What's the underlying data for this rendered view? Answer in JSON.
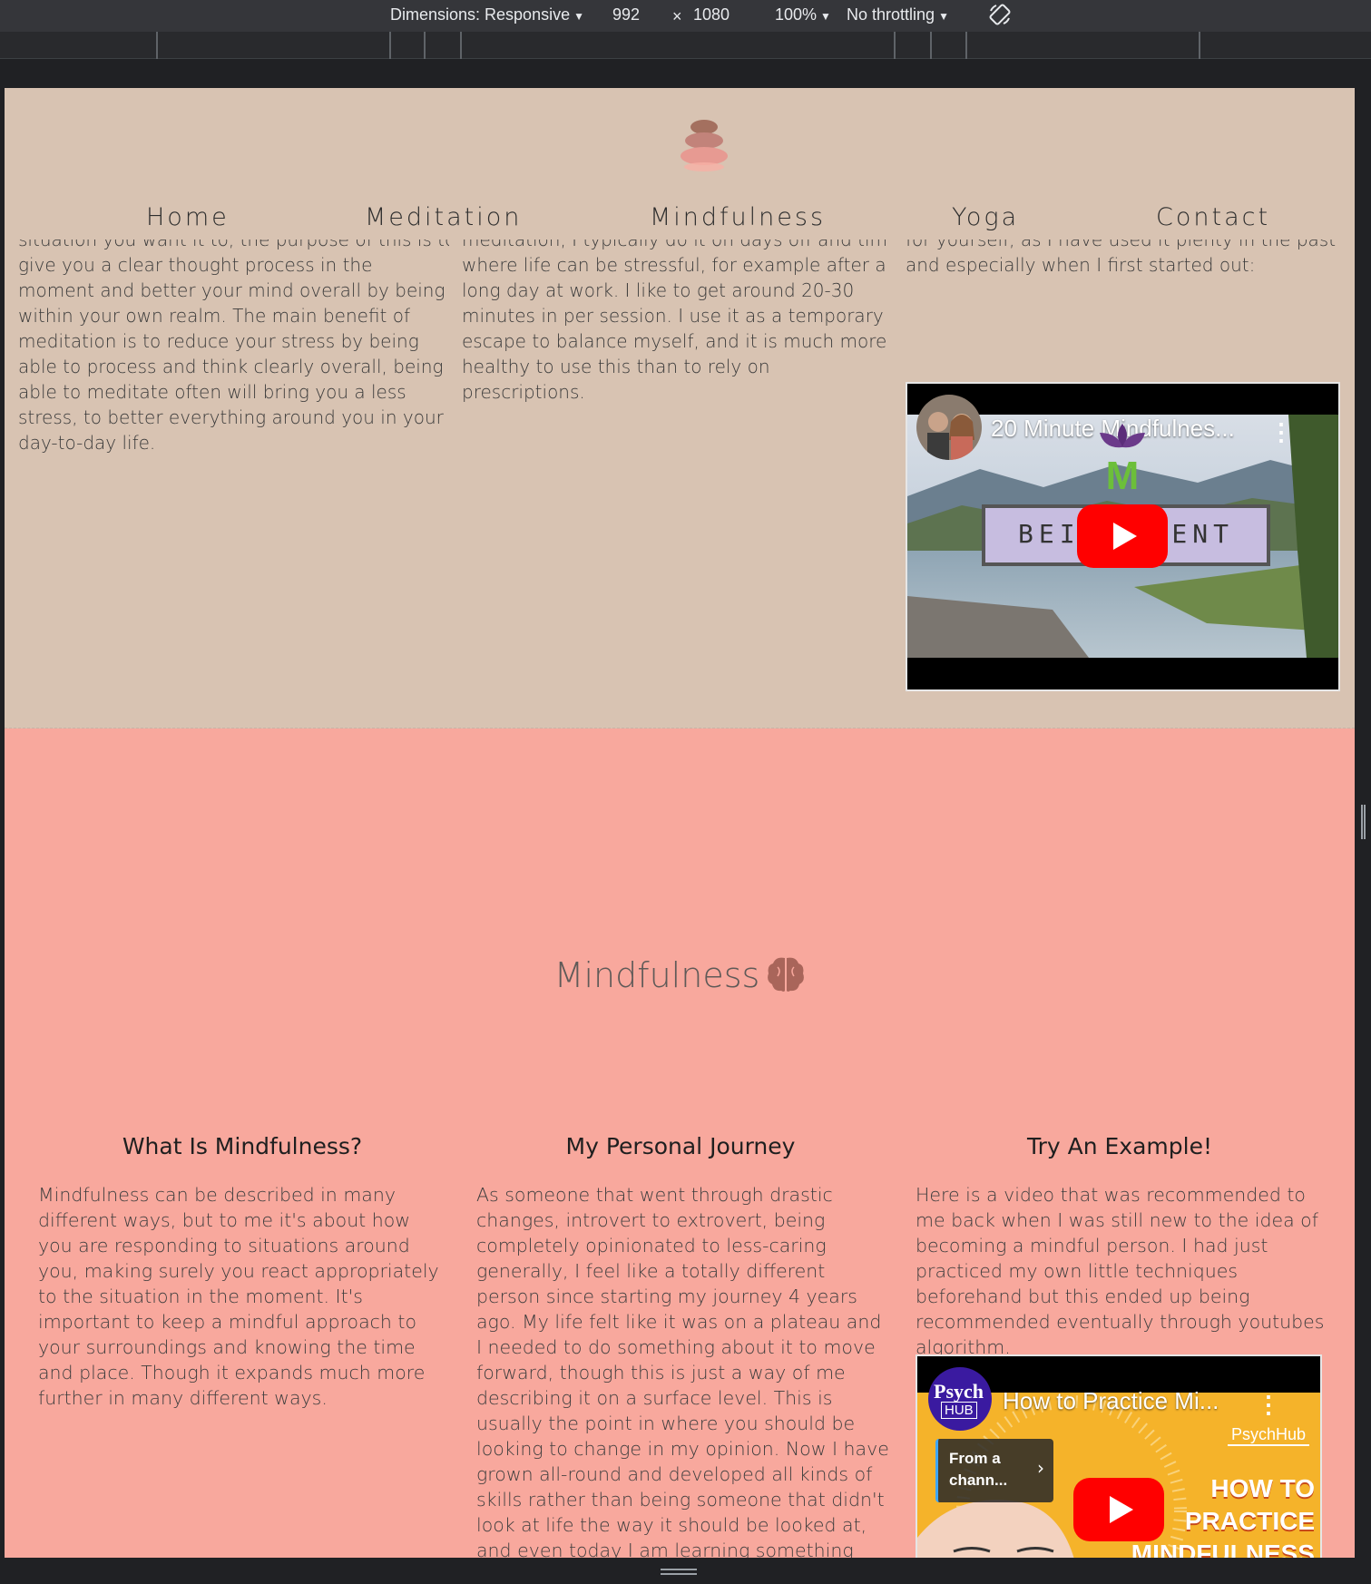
{
  "devtools": {
    "dimensions_label": "Dimensions: Responsive",
    "width": "992",
    "times": "×",
    "height": "1080",
    "zoom": "100%",
    "throttling": "No throttling",
    "rotate_icon": "rotate-icon"
  },
  "nav": {
    "items": [
      "Home",
      "Meditation",
      "Mindfulness",
      "Yoga",
      "Contact"
    ]
  },
  "meditation": {
    "col1_clipped": "situation you want it to, the purpose of this is to",
    "col1_text": "give you a clear thought process in the moment and better your mind overall by being within your own realm. The main benefit of meditation is to reduce your stress by being able to process and think clearly overall, being able to meditate often will bring you a less stress, to better everything around you in your day-to-day life.",
    "col2_clipped": "meditation, I typically do it on days off and times",
    "col2_text": "where life can be stressful, for example after a long day at work. I like to get around 20-30 minutes in per session. I use it as a temporary escape to balance myself, and it is much more healthy to use this than to rely on prescriptions.",
    "col3_clipped": "for yourself, as I have used it plenty in the past",
    "col3_text": "and especially when I first started out:",
    "video": {
      "title": "20 Minute Mindfulnes...",
      "overlay_left": "BEIN",
      "overlay_right": "SENT"
    }
  },
  "mindfulness": {
    "heading": "Mindfulness",
    "col1_title": "What Is Mindfulness?",
    "col1_text": "Mindfulness can be described in many different ways, but to me it's about how you are responding to situations around you, making surely you react appropriately to the situation in the moment. It's important to keep a mindful approach to your surroundings and knowing the time and place. Though it expands much more further in many different ways.",
    "col2_title": "My Personal Journey",
    "col2_text": "As someone that went through drastic changes, introvert to extrovert, being completely opinionated to less-caring generally, I feel like a totally different person since starting my journey 4 years ago. My life felt like it was on a plateau and I needed to do something about it to move forward, though this is just a way of me describing it on a surface level. This is usually the point in where you should be looking to change in my opinion. Now I have grown all-round and developed all kinds of skills rather than being someone that didn't look at life the way it should be looked at, and even today I am learning something new!",
    "col3_title": "Try An Example!",
    "col3_text": "Here is a video that was recommended to me back when I was still new to the idea of becoming a mindful person. I had just practiced my own little techniques beforehand but this ended up being recommended eventually through youtubes algorithm.",
    "video": {
      "channel_top": "Psych",
      "channel_bottom": "HUB",
      "title": "How to Practice Mi...",
      "from_line1": "From a",
      "from_line2": "chann...",
      "watermark": "PsychHub",
      "thumb_line1": "HOW TO",
      "thumb_line2": "PRACTICE",
      "thumb_line3": "MINDFULNESS"
    }
  },
  "colors": {
    "header_bg": "#d8c3b2",
    "mindfulness_bg": "#f8a89d",
    "youtube_red": "#ff0000"
  }
}
